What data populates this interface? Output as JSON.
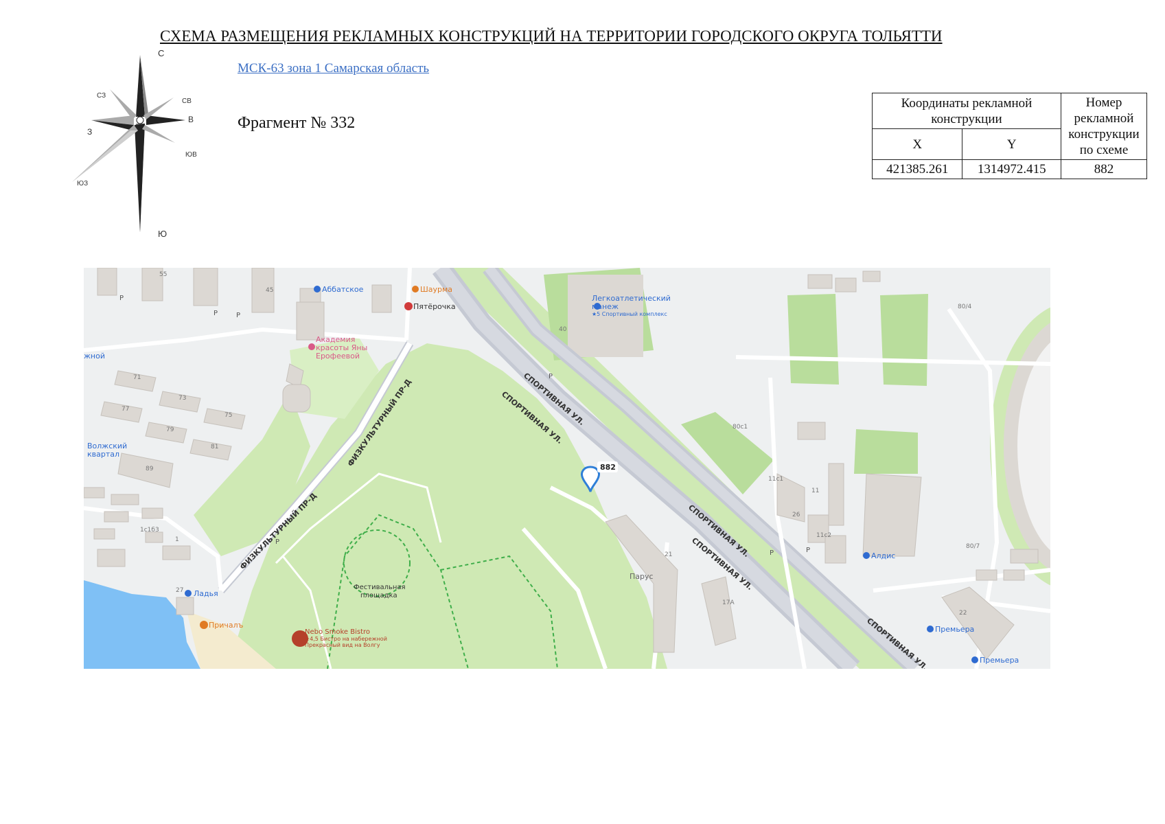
{
  "header": {
    "title": "СХЕМА РАЗМЕЩЕНИЯ РЕКЛАМНЫХ КОНСТРУКЦИЙ НА ТЕРРИТОРИИ ГОРОДСКОГО ОКРУГА ТОЛЬЯТТИ",
    "crs_link": "МСК-63 зона 1 Самарская область",
    "fragment_label": "Фрагмент №",
    "fragment_number": "332"
  },
  "compass": {
    "icon": "compass-rose-icon",
    "labels": {
      "n": "С",
      "ne": "СВ",
      "e": "В",
      "se": "ЮВ",
      "s": "Ю",
      "sw": "ЮЗ",
      "w": "З",
      "nw": "СЗ"
    }
  },
  "coords_table": {
    "header_coords": "Координаты рекламной конструкции",
    "header_number": "Номер рекламной конструкции по схеме",
    "col_x": "X",
    "col_y": "Y",
    "row": {
      "x": "421385.261",
      "y": "1314972.415",
      "number": "882"
    }
  },
  "map": {
    "colors": {
      "land": "#eef0f1",
      "park": "#cfe9b4",
      "field": "#b9dd9c",
      "water": "#7fc0f5",
      "road": "#ffffff",
      "highway": "#c5c9d3",
      "building": "#dcd8d3"
    },
    "marker": {
      "label": "882",
      "icon": "location-pin-icon"
    },
    "streets": {
      "sportivnaya": "СПОРТИВНАЯ УЛ.",
      "fizkulturny": "ФИЗКУЛЬТУРНЫЙ ПР-Д"
    },
    "pois": {
      "abbatskoe": "Аббатское",
      "shaurma": "Шаурма",
      "pyaterochka": "Пятёрочка",
      "academy_1": "Академия",
      "academy_2": "красоты Яны",
      "academy_3": "Ерофеевой",
      "manezh_1": "Легкоатлетический",
      "manezh_2": "манеж",
      "manezh_3": "★5 Спортивный комплекс",
      "festival_1": "Фестивальная",
      "festival_2": "площадка",
      "ladya": "Ладья",
      "prichal": "Причалъ",
      "nebo_1": "Nebo Smoke Bistro",
      "nebo_2": "★4,5 Бистро на набережной",
      "nebo_3": "Прекрасный вид на Волгу",
      "aldis": "Алдис",
      "premiera_1": "Премьера",
      "premiera_2": "Премьера",
      "parus": "Парус",
      "volzhsky_1": "Волжский",
      "volzhsky_2": "квартал",
      "edge_fragment": "жной"
    },
    "house_numbers": [
      "55",
      "45",
      "40",
      "71",
      "73",
      "75",
      "77",
      "79",
      "81",
      "89",
      "1с1б3",
      "1",
      "27",
      "80с1",
      "11с1",
      "11",
      "26",
      "11с2",
      "21",
      "17А",
      "80/4",
      "80/7",
      "22"
    ],
    "parking": "P"
  }
}
